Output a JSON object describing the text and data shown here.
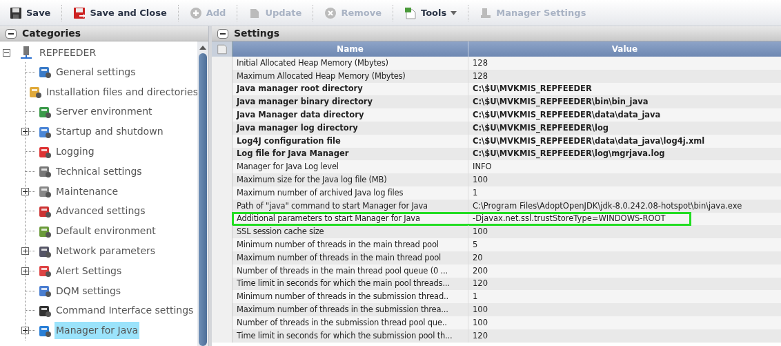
{
  "toolbar": [
    {
      "label": "Save",
      "disabled": false,
      "dropdown": false
    },
    {
      "label": "Save and Close",
      "disabled": false,
      "dropdown": false
    },
    {
      "label": "Add",
      "disabled": true,
      "dropdown": false
    },
    {
      "label": "Update",
      "disabled": true,
      "dropdown": false
    },
    {
      "label": "Remove",
      "disabled": true,
      "dropdown": false
    },
    {
      "label": "Tools",
      "disabled": false,
      "dropdown": true
    },
    {
      "label": "Manager Settings",
      "disabled": true,
      "dropdown": false
    }
  ],
  "categories": {
    "title": "Categories",
    "tree": [
      {
        "label": "REPFEEDER",
        "expanded": true,
        "selected": false,
        "children": [
          {
            "label": "General settings",
            "expandable": false,
            "selected": false
          },
          {
            "label": "Installation files and directories",
            "expandable": false,
            "selected": false
          },
          {
            "label": "Server environment",
            "expandable": false,
            "selected": false
          },
          {
            "label": "Startup and shutdown",
            "expandable": true,
            "selected": false
          },
          {
            "label": "Logging",
            "expandable": false,
            "selected": false
          },
          {
            "label": "Technical settings",
            "expandable": false,
            "selected": false
          },
          {
            "label": "Maintenance",
            "expandable": true,
            "selected": false
          },
          {
            "label": "Advanced settings",
            "expandable": false,
            "selected": false
          },
          {
            "label": "Default environment",
            "expandable": false,
            "selected": false
          },
          {
            "label": "Network parameters",
            "expandable": true,
            "selected": false
          },
          {
            "label": "Alert Settings",
            "expandable": true,
            "selected": false
          },
          {
            "label": "DQM settings",
            "expandable": false,
            "selected": false
          },
          {
            "label": "Command Interface settings",
            "expandable": false,
            "selected": false
          },
          {
            "label": "Manager for Java",
            "expandable": true,
            "selected": true
          }
        ]
      }
    ]
  },
  "settings": {
    "title": "Settings",
    "columns": [
      "Name",
      "Value"
    ],
    "rows": [
      {
        "name": "Initial Allocated Heap Memory (Mbytes)",
        "value": "128",
        "bold": false,
        "highlighted": false
      },
      {
        "name": "Maximum Allocated Heap Memory (Mbytes)",
        "value": "128",
        "bold": false,
        "highlighted": false
      },
      {
        "name": "Java manager root directory",
        "value": "C:\\$U\\MVKMIS_REPFEEDER",
        "bold": true,
        "highlighted": false
      },
      {
        "name": "Java manager binary directory",
        "value": "C:\\$U\\MVKMIS_REPFEEDER\\bin\\bin_java",
        "bold": true,
        "highlighted": false
      },
      {
        "name": "Java Manager data directory",
        "value": "C:\\$U\\MVKMIS_REPFEEDER\\data\\data_java",
        "bold": true,
        "highlighted": false
      },
      {
        "name": "Java manager log directory",
        "value": "C:\\$U\\MVKMIS_REPFEEDER\\log",
        "bold": true,
        "highlighted": false
      },
      {
        "name": "Log4J configuration file",
        "value": "C:\\$U\\MVKMIS_REPFEEDER\\data\\data_java\\log4j.xml",
        "bold": true,
        "highlighted": false
      },
      {
        "name": "Log file for Java Manager",
        "value": "C:\\$U\\MVKMIS_REPFEEDER\\log\\mgrjava.log",
        "bold": true,
        "highlighted": false
      },
      {
        "name": "Manager for Java Log level",
        "value": "INFO",
        "bold": false,
        "highlighted": false
      },
      {
        "name": "Maximum size for the Java log file (MB)",
        "value": "100",
        "bold": false,
        "highlighted": false
      },
      {
        "name": "Maximum number of archived Java log files",
        "value": "1",
        "bold": false,
        "highlighted": false
      },
      {
        "name": "Path of \"java\" command to start Manager for Java",
        "value": "C:\\Program Files\\AdoptOpenJDK\\jdk-8.0.242.08-hotspot\\bin\\java.exe",
        "bold": false,
        "highlighted": false
      },
      {
        "name": "Additional parameters to start Manager for Java",
        "value": "-Djavax.net.ssl.trustStoreType=WINDOWS-ROOT",
        "bold": false,
        "highlighted": true
      },
      {
        "name": "SSL session cache size",
        "value": "100",
        "bold": false,
        "highlighted": false
      },
      {
        "name": "Minimum number of threads in the main thread pool",
        "value": "5",
        "bold": false,
        "highlighted": false
      },
      {
        "name": "Maximum number of threads in the main thread pool",
        "value": "20",
        "bold": false,
        "highlighted": false
      },
      {
        "name": "Number of threads in the main thread pool queue (0 ...",
        "value": "200",
        "bold": false,
        "highlighted": false
      },
      {
        "name": "Time limit in seconds for which the main pool threads...",
        "value": "120",
        "bold": false,
        "highlighted": false
      },
      {
        "name": "Minimum number of threads in the submission thread..",
        "value": "1",
        "bold": false,
        "highlighted": false
      },
      {
        "name": "Maximum number of threads in the submission threa...",
        "value": "100",
        "bold": false,
        "highlighted": false
      },
      {
        "name": "Number of threads in the submission thread pool que..",
        "value": "100",
        "bold": false,
        "highlighted": false
      },
      {
        "name": "Time limit in seconds for which the submission pool th...",
        "value": "120",
        "bold": false,
        "highlighted": false
      }
    ]
  }
}
